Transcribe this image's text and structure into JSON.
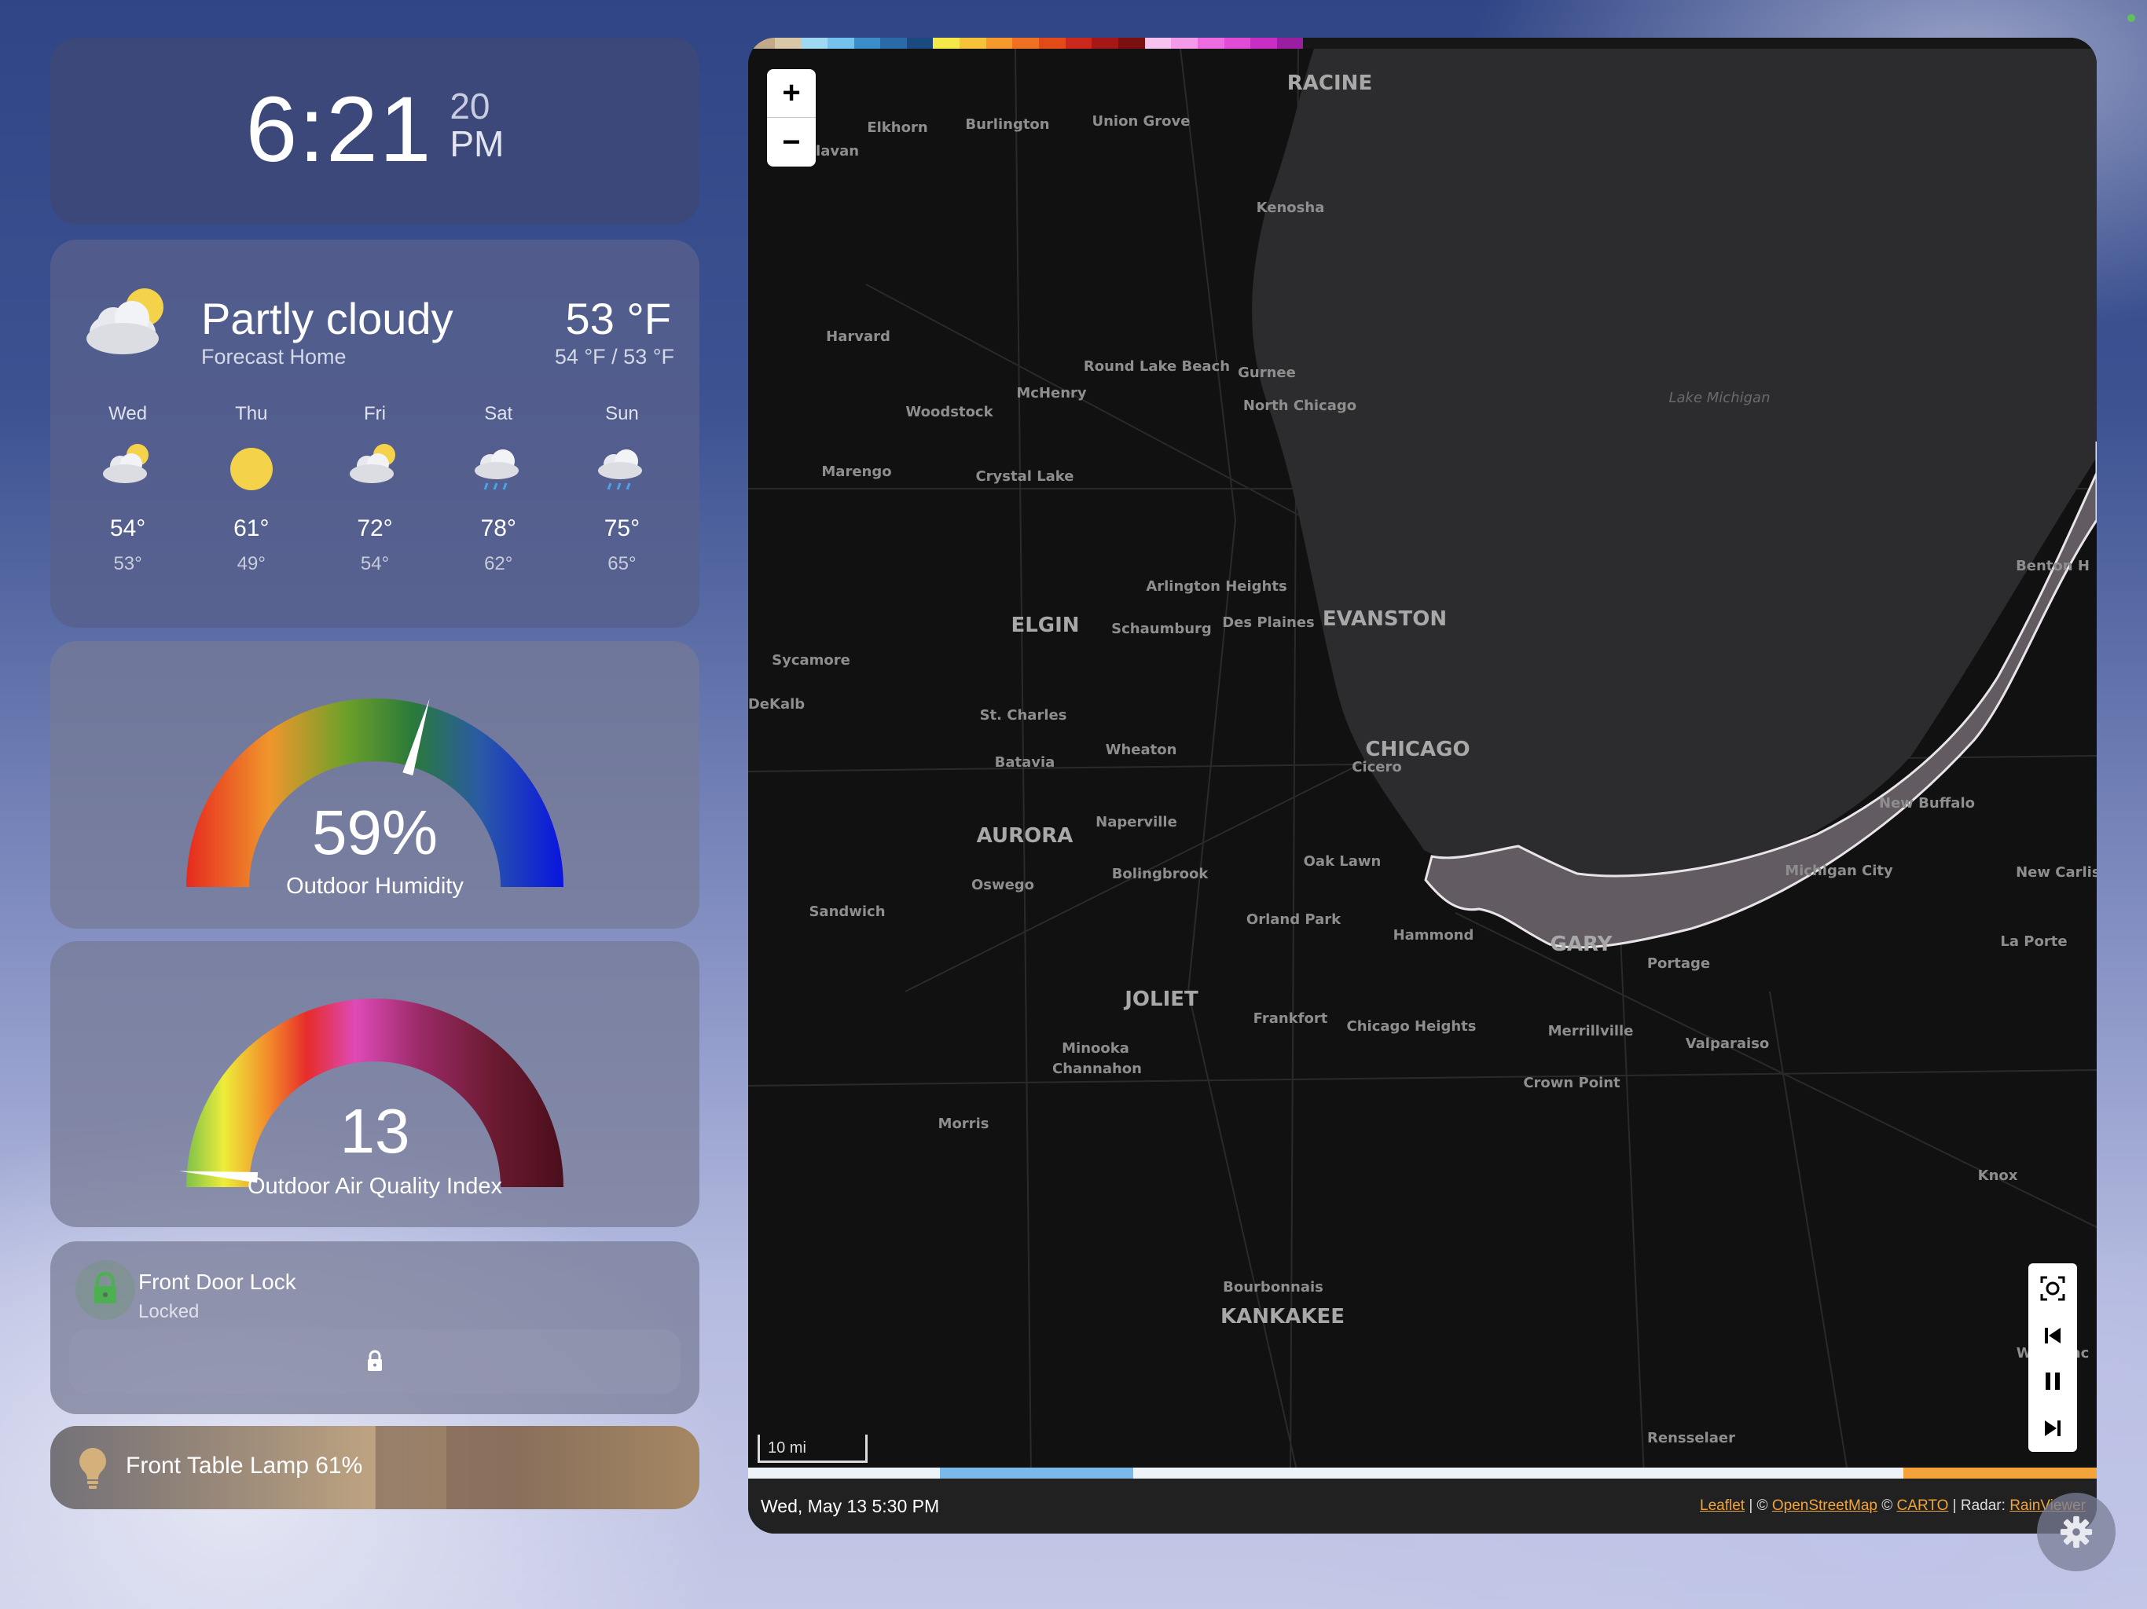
{
  "clock": {
    "time": "6:21",
    "seconds": "20",
    "ampm": "PM"
  },
  "weather": {
    "condition": "Partly cloudy",
    "source": "Forecast Home",
    "temperature": "53 °F",
    "range": "54 °F / 53 °F",
    "icon": "partly-cloudy-icon",
    "forecast": [
      {
        "day": "Wed",
        "icon": "partly-cloudy-icon",
        "high": "54°",
        "low": "53°"
      },
      {
        "day": "Thu",
        "icon": "sunny-icon",
        "high": "61°",
        "low": "49°"
      },
      {
        "day": "Fri",
        "icon": "partly-cloudy-icon",
        "high": "72°",
        "low": "54°"
      },
      {
        "day": "Sat",
        "icon": "rainy-icon",
        "high": "78°",
        "low": "62°"
      },
      {
        "day": "Sun",
        "icon": "rainy-icon",
        "high": "75°",
        "low": "65°"
      }
    ]
  },
  "humidity": {
    "value": "59%",
    "label": "Outdoor Humidity",
    "level_percent": 59
  },
  "aqi": {
    "value": "13",
    "label": "Outdoor Air Quality Index",
    "level_fraction": 0.026
  },
  "lock": {
    "name": "Front Door Lock",
    "state": "Locked",
    "icon": "lock-icon",
    "button_icon": "padlock-icon"
  },
  "lamp": {
    "label": "Front Table Lamp 61%",
    "brightness_percent": 61,
    "icon": "lightbulb-icon"
  },
  "map": {
    "zoom_in": "+",
    "zoom_out": "−",
    "scale": "10 mi",
    "timestamp": "Wed, May 13 5:30 PM",
    "attribution": {
      "leaflet": "Leaflet",
      "sep1": " | © ",
      "osm": "OpenStreetMap",
      "sep2": " © ",
      "carto": "CARTO",
      "sep3": " | Radar: ",
      "rainviewer": "RainViewer"
    },
    "lake_label": "Lake Michigan",
    "cities": [
      {
        "name": "RACINE",
        "size": "large"
      },
      {
        "name": "Elkhorn"
      },
      {
        "name": "Burlington"
      },
      {
        "name": "Union Grove"
      },
      {
        "name": "Delavan"
      },
      {
        "name": "Kenosha"
      },
      {
        "name": "Harvard"
      },
      {
        "name": "Round Lake Beach"
      },
      {
        "name": "Gurnee"
      },
      {
        "name": "McHenry"
      },
      {
        "name": "Woodstock"
      },
      {
        "name": "North Chicago"
      },
      {
        "name": "Marengo"
      },
      {
        "name": "Crystal Lake"
      },
      {
        "name": "Arlington Heights"
      },
      {
        "name": "ELGIN",
        "size": "large"
      },
      {
        "name": "Schaumburg"
      },
      {
        "name": "Des Plaines"
      },
      {
        "name": "EVANSTON",
        "size": "large"
      },
      {
        "name": "Sycamore"
      },
      {
        "name": "DeKalb"
      },
      {
        "name": "St. Charles"
      },
      {
        "name": "Wheaton"
      },
      {
        "name": "CHICAGO",
        "size": "large"
      },
      {
        "name": "Batavia"
      },
      {
        "name": "Cicero"
      },
      {
        "name": "AURORA",
        "size": "large"
      },
      {
        "name": "Naperville"
      },
      {
        "name": "Oak Lawn"
      },
      {
        "name": "Bolingbrook"
      },
      {
        "name": "Oswego"
      },
      {
        "name": "Sandwich"
      },
      {
        "name": "Orland Park"
      },
      {
        "name": "Hammond"
      },
      {
        "name": "GARY",
        "size": "large"
      },
      {
        "name": "Portage"
      },
      {
        "name": "JOLIET",
        "size": "large"
      },
      {
        "name": "Frankfort"
      },
      {
        "name": "Chicago Heights"
      },
      {
        "name": "Minooka"
      },
      {
        "name": "Channahon"
      },
      {
        "name": "Merrillville"
      },
      {
        "name": "Valparaiso"
      },
      {
        "name": "Crown Point"
      },
      {
        "name": "Morris"
      },
      {
        "name": "Michigan City"
      },
      {
        "name": "New Buffalo"
      },
      {
        "name": "New Carlisle"
      },
      {
        "name": "La Porte"
      },
      {
        "name": "Benton H"
      },
      {
        "name": "Knox"
      },
      {
        "name": "Bourbonnais"
      },
      {
        "name": "KANKAKEE",
        "size": "large"
      },
      {
        "name": "Winamac"
      },
      {
        "name": "Rensselaer"
      }
    ],
    "radar_scale_colors": [
      "#c2a98a",
      "#d9c8a8",
      "#9fd8f2",
      "#74c3ef",
      "#3b8dc9",
      "#2a6aa6",
      "#1a4a80",
      "#f5e94a",
      "#f5c23a",
      "#f59a2a",
      "#ef7020",
      "#e24a18",
      "#c9281a",
      "#a61818",
      "#7a1010",
      "#f7c2f0",
      "#f39be8",
      "#ec6cdf",
      "#e24bd6",
      "#c82ec4",
      "#9b1ea0",
      "#161616",
      "#161616",
      "#161616",
      "#161616",
      "#161616",
      "#161616",
      "#161616",
      "#161616",
      "#161616",
      "#161616",
      "#161616",
      "#161616",
      "#161616",
      "#161616",
      "#161616",
      "#161616",
      "#161616",
      "#161616",
      "#161616",
      "#161616",
      "#161616",
      "#161616",
      "#161616",
      "#161616",
      "#161616",
      "#161616",
      "#161616",
      "#161616",
      "#161616",
      "#161616"
    ]
  },
  "settings": {
    "icon": "gear-icon"
  }
}
